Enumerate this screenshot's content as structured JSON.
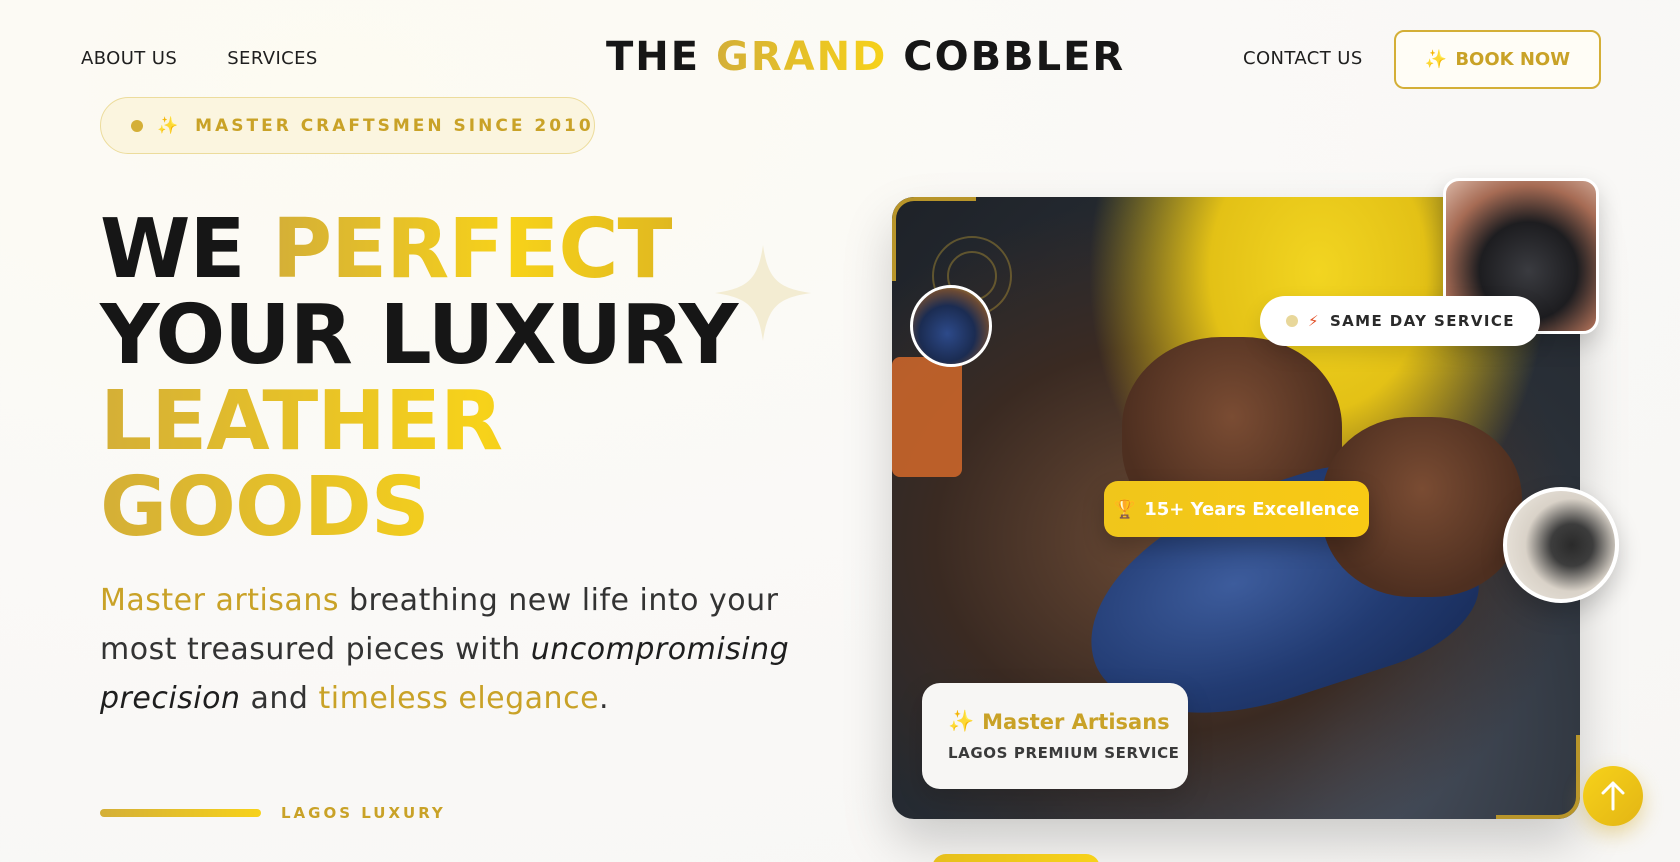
{
  "nav": {
    "about": "ABOUT US",
    "services": "SERVICES",
    "contact": "CONTACT US",
    "book_icon": "✨",
    "book_label": "BOOK NOW"
  },
  "logo": {
    "part1": "THE",
    "part2": "GRAND",
    "part3": "COBBLER"
  },
  "badge": {
    "icon": "✨",
    "text": "MASTER CRAFTSMEN SINCE 2010"
  },
  "headline": {
    "w1": "WE",
    "w2": "PERFECT",
    "line2": "YOUR LUXURY",
    "line3": "LEATHER",
    "line4": "GOODS"
  },
  "description": {
    "p1": "Master artisans",
    "p2": " breathing new life into your most treasured pieces with ",
    "p3": "uncompromising precision",
    "p4": " and ",
    "p5": "timeless elegance",
    "p6": "."
  },
  "tagline": "LAGOS LUXURY",
  "hero": {
    "same_day": "SAME DAY SERVICE",
    "same_day_icon": "⚡",
    "years_icon": "🏆",
    "years": "15+ Years Excellence",
    "artisans_icon": "✨",
    "artisans_title": "Master Artisans",
    "artisans_sub": "LAGOS PREMIUM SERVICE"
  },
  "colors": {
    "gold": "#d4af37",
    "yellow": "#f7d21a",
    "dark": "#161616"
  },
  "icons": [
    "sparkle-icon",
    "bolt-icon",
    "trophy-icon",
    "arrow-up-icon"
  ]
}
